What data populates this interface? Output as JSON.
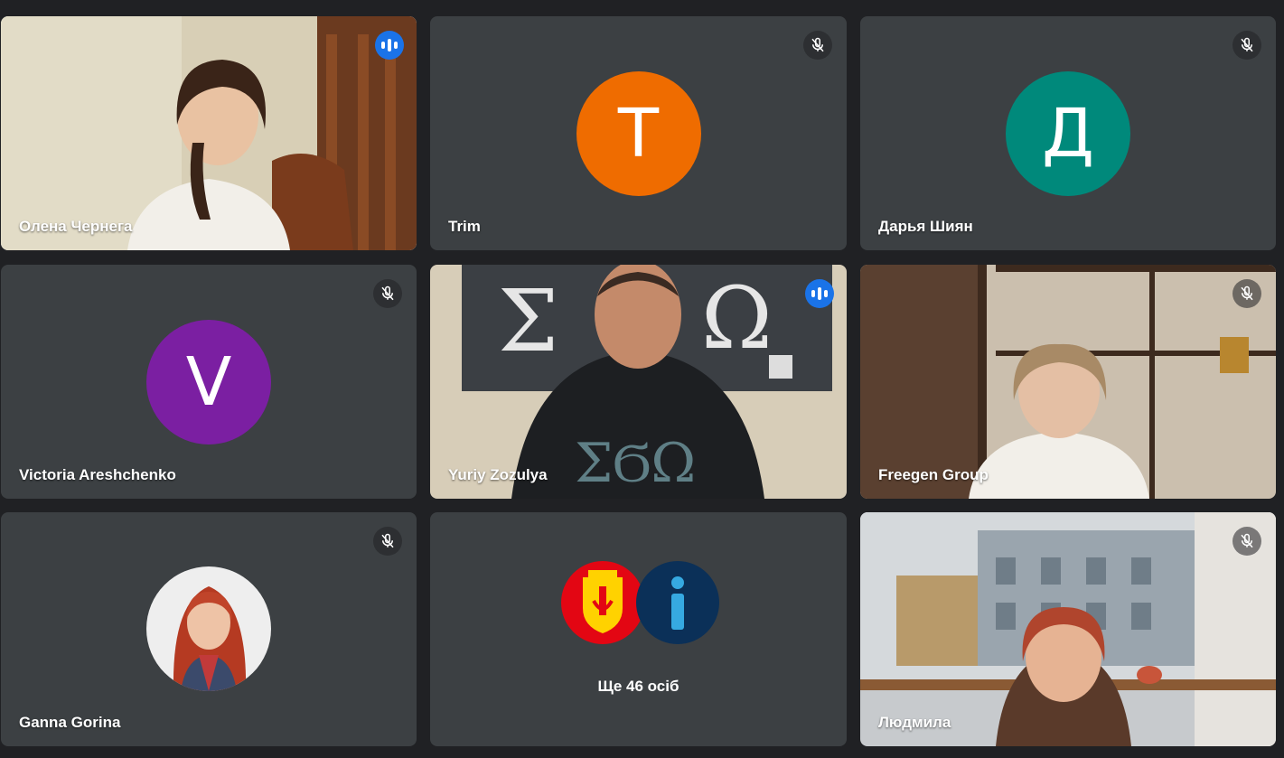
{
  "participants": [
    {
      "name": "Олена Чернега",
      "state": "speaking",
      "type": "video"
    },
    {
      "name": "Trim",
      "state": "muted",
      "type": "avatar",
      "initial": "T",
      "color": "#ef6c00"
    },
    {
      "name": "Дарья Шиян",
      "state": "muted",
      "type": "avatar",
      "initial": "Д",
      "color": "#00897b"
    },
    {
      "name": "Victoria Areshchenko",
      "state": "muted",
      "type": "avatar",
      "initial": "V",
      "color": "#7b1fa2"
    },
    {
      "name": "Yuriy Zozulya",
      "state": "speaking",
      "type": "video"
    },
    {
      "name": "Freegen Group",
      "state": "muted",
      "type": "video"
    },
    {
      "name": "Ganna Gorina",
      "state": "muted",
      "type": "photo"
    },
    {
      "name": "Людмила",
      "state": "muted",
      "type": "video"
    }
  ],
  "overflow": {
    "label": "Ще 46 осіб"
  },
  "colors": {
    "background": "#202124",
    "tile": "#3c4043",
    "active_outline": "#8ab4f8",
    "speaking": "#1a73e8"
  },
  "icons": {
    "muted": "mic-off-icon",
    "speaking": "audio-level-icon"
  }
}
